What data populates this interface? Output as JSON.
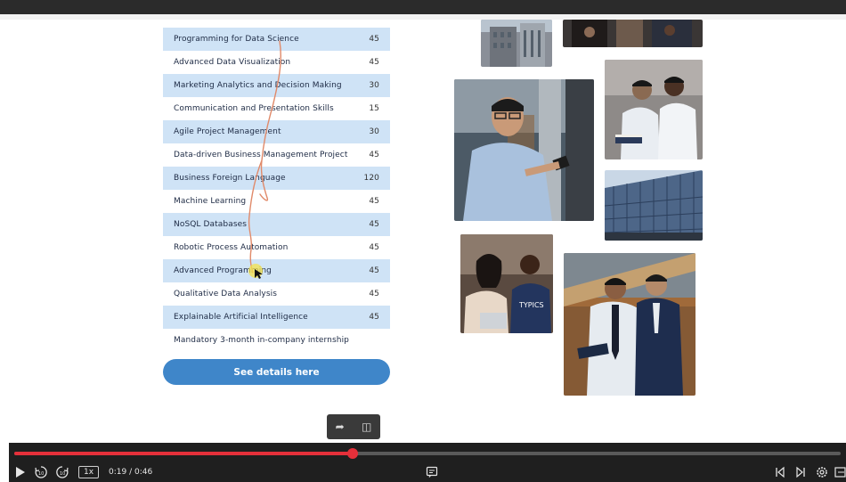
{
  "courses": [
    {
      "name": "Programming for Data Science",
      "hours": "45",
      "shaded": true
    },
    {
      "name": "Advanced Data Visualization",
      "hours": "45",
      "shaded": false
    },
    {
      "name": "Marketing Analytics and Decision Making",
      "hours": "30",
      "shaded": true
    },
    {
      "name": "Communication and Presentation Skills",
      "hours": "15",
      "shaded": false
    },
    {
      "name": "Agile Project Management",
      "hours": "30",
      "shaded": true
    },
    {
      "name": "Data-driven Business Management Project",
      "hours": "45",
      "shaded": false
    },
    {
      "name": "Business Foreign Language",
      "hours": "120",
      "shaded": true
    },
    {
      "name": "Machine Learning",
      "hours": "45",
      "shaded": false
    },
    {
      "name": "NoSQL Databases",
      "hours": "45",
      "shaded": true
    },
    {
      "name": "Robotic Process Automation",
      "hours": "45",
      "shaded": false
    },
    {
      "name": "Advanced Programming",
      "hours": "45",
      "shaded": true
    },
    {
      "name": "Qualitative Data Analysis",
      "hours": "45",
      "shaded": false
    },
    {
      "name": "Explainable Artificial Intelligence",
      "hours": "45",
      "shaded": true
    },
    {
      "name": "Mandatory 3-month in-company internship",
      "hours": "",
      "shaded": false
    }
  ],
  "details_button_label": "See details here",
  "player": {
    "speed": "1x",
    "time": "0:19 / 0:46",
    "progress": 0.41,
    "accent_color": "#e5303a",
    "icons": [
      "play-icon",
      "rewind-10-icon",
      "forward-10-icon",
      "transcript-icon",
      "previous-icon",
      "next-icon",
      "settings-icon",
      "fullscreen-icon"
    ]
  },
  "mini_toolbar_icons": [
    "share-icon",
    "note-icon"
  ],
  "brand_color": "#3f86c9",
  "row_shade_color": "#cfe3f6"
}
